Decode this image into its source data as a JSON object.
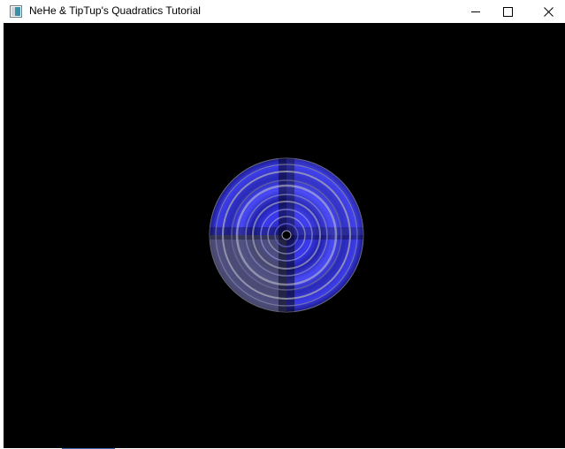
{
  "window": {
    "title": "NeHe & TipTup's Quadratics Tutorial",
    "controls": {
      "minimize_icon": "minimize-icon",
      "maximize_icon": "maximize-icon",
      "close_icon": "close-icon"
    },
    "app_icon": "opengl-window-icon"
  },
  "scene": {
    "background_color": "#000000",
    "object": "textured-disk",
    "texture_colors": {
      "primary": "#2b2bd6",
      "secondary": "#7f7f86",
      "dark": "#05051a"
    }
  }
}
